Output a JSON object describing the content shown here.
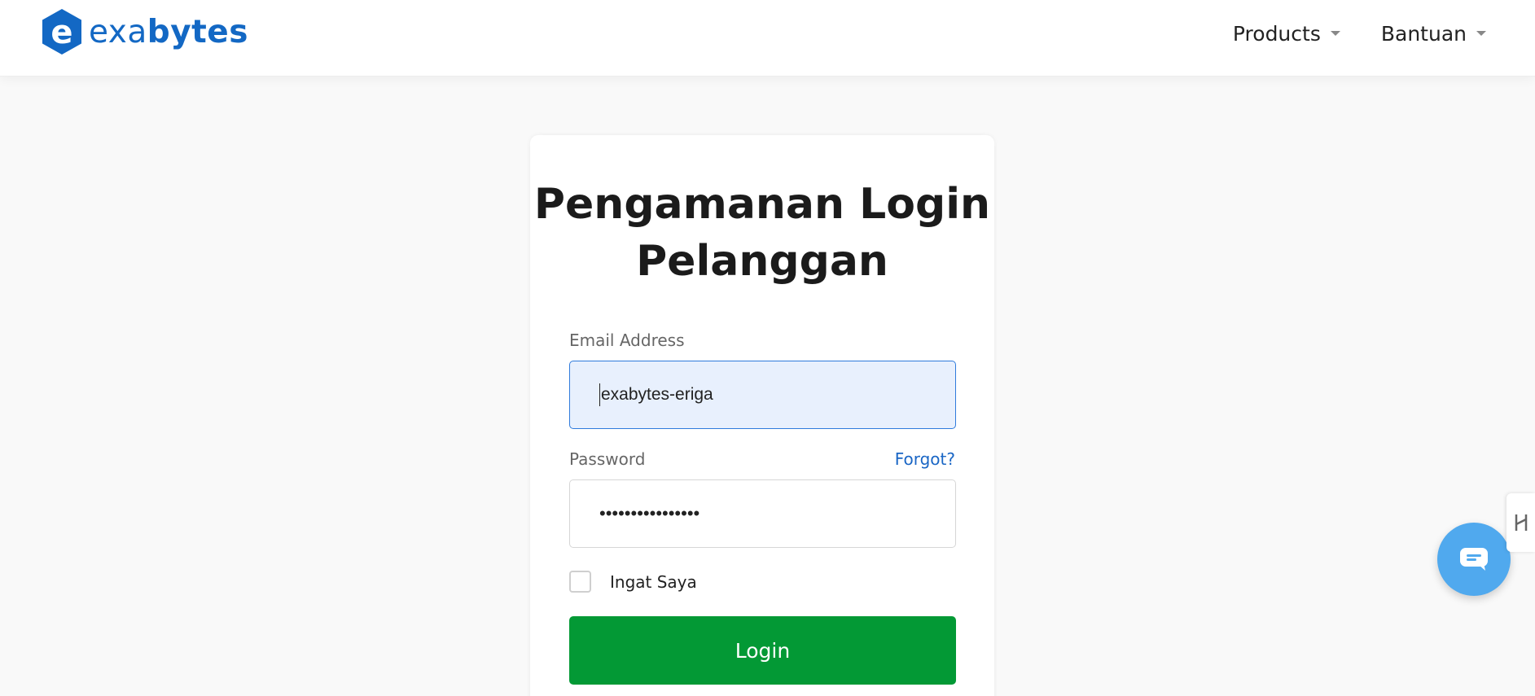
{
  "brand": {
    "name_part1": "exa",
    "name_part2": "bytes",
    "mark_letter": "e",
    "color": "#1368c4"
  },
  "nav": {
    "items": [
      {
        "label": "Products"
      },
      {
        "label": "Bantuan"
      }
    ]
  },
  "login": {
    "title_line1": "Pengamanan Login",
    "title_line2": "Pelanggan",
    "email_label": "Email Address",
    "email_value": "exabytes-eriga",
    "password_label": "Password",
    "forgot_label": "Forgot?",
    "password_value": "••••••••••••••••",
    "remember_label": "Ingat Saya",
    "remember_checked": false,
    "submit_label": "Login"
  },
  "colors": {
    "primary_button": "#039935",
    "link": "#1a66c5",
    "chat_button": "#50a9ee",
    "input_focus_bg": "#e8f0fd"
  },
  "icons": {
    "chat": "chat-bubble-icon",
    "side_tab": "hotjar-icon",
    "nav_caret": "caret-down-icon"
  }
}
